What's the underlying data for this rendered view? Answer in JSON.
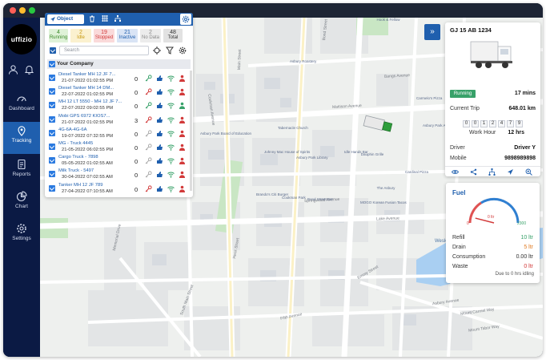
{
  "window": {
    "dots": [
      "#ff5f57",
      "#febc2e",
      "#28c840"
    ]
  },
  "brand": {
    "logo_text": "uffizio"
  },
  "sidebar": {
    "items": [
      {
        "label": "Dashboard",
        "icon": "speedometer-icon"
      },
      {
        "label": "Tracking",
        "icon": "location-pin-icon"
      },
      {
        "label": "Reports",
        "icon": "report-icon"
      },
      {
        "label": "Chart",
        "icon": "pie-chart-icon"
      },
      {
        "label": "Settings",
        "icon": "gear-icon"
      }
    ]
  },
  "panel": {
    "tab_object": "Object",
    "stats": [
      {
        "value": "4",
        "label": "Running",
        "bg": "#dff2d8",
        "color": "#3b8a2a"
      },
      {
        "value": "2",
        "label": "Idle",
        "bg": "#fbf1cf",
        "color": "#c79a12"
      },
      {
        "value": "19",
        "label": "Stopped",
        "bg": "#fadada",
        "color": "#d23a3a"
      },
      {
        "value": "21",
        "label": "Inactive",
        "bg": "#d9e4f5",
        "color": "#1f5fae"
      },
      {
        "value": "2",
        "label": "No Data",
        "bg": "#ececec",
        "color": "#888888"
      },
      {
        "value": "48",
        "label": "Total",
        "bg": "#e2e2e2",
        "color": "#333333"
      }
    ],
    "search_placeholder": "Search",
    "company": "Your Company",
    "rows": [
      {
        "name": "Diesel Tanker MH 12 JF 7...",
        "date": "21-07-2022 01:02:55 PM",
        "count": "0",
        "key": "#38a169",
        "person": "#d23a3a"
      },
      {
        "name": "Diesel Tanker MH 14 DM...",
        "date": "22-07-2022 01:02:55 PM",
        "count": "0",
        "key": "#d23a3a",
        "person": "#d23a3a"
      },
      {
        "name": "MH 12 LT 5550 - MH 12 JF 7...",
        "date": "22-07-2022 09:02:55 PM",
        "count": "0",
        "key": "#38a169",
        "person": "#38a169"
      },
      {
        "name": "Mobi GPS 6972 KIOS7...",
        "date": "21-07-2022 01:02:55 PM",
        "count": "3",
        "key": "#d23a3a",
        "person": "#d23a3a"
      },
      {
        "name": "4G-6A-4G-6A",
        "date": "19-07-2022 07:32:55 PM",
        "count": "0",
        "key": "#aaaaaa",
        "person": "#d23a3a"
      },
      {
        "name": "MG - Truck 4445",
        "date": "21-05-2022 06:02:55 PM",
        "count": "0",
        "key": "#aaaaaa",
        "person": "#d23a3a"
      },
      {
        "name": "Cargo Truck - 7898",
        "date": "05-05-2022 01:02:55 AM",
        "count": "0",
        "key": "#aaaaaa",
        "person": "#d23a3a"
      },
      {
        "name": "Milk Truck - 5497",
        "date": "30-04-2022 07:02:55 AM",
        "count": "0",
        "key": "#aaaaaa",
        "person": "#d23a3a"
      },
      {
        "name": "Tanker MH 12 JF 789",
        "date": "27-04-2022 07:10:55 AM",
        "count": "0",
        "key": "#d23a3a",
        "person": "#d23a3a"
      }
    ]
  },
  "vehicle": {
    "plate": "GJ 15 AB 1234",
    "status": "Running",
    "status_duration": "17 mins",
    "current_trip_label": "Current Trip",
    "current_trip_value": "648.01 km",
    "odometer_digits": [
      "0",
      "0",
      "1",
      "2",
      "4",
      "7",
      "9"
    ],
    "work_hour_label": "Work Hour",
    "work_hour_value": "12 hrs",
    "driver_label": "Driver",
    "driver_value": "Driver Y",
    "mobile_label": "Mobile",
    "mobile_value": "9898989898"
  },
  "fuel": {
    "title": "Fuel",
    "gauge_min": "0",
    "gauge_max": "2300",
    "gauge_value": "0 ltr",
    "gauge_fraction": 0.0,
    "rows": [
      {
        "label": "Refill",
        "value": "10 ltr",
        "color": "#38a169"
      },
      {
        "label": "Drain",
        "value": "5 ltr",
        "color": "#e07b22"
      },
      {
        "label": "Consumption",
        "value": "0.00 ltr",
        "color": "#333333"
      },
      {
        "label": "Waste",
        "value": "0 ltr",
        "color": "#d23a3a"
      }
    ],
    "footer": "Due to 0 hrs idling"
  },
  "map": {
    "roads": [
      "Springwood Avenue",
      "Main Street",
      "Lake Avenue",
      "Bangs Avenue",
      "Mattison Avenue",
      "Cookman Avenue",
      "Bond Street",
      "South Main Street",
      "Asbury Avenue",
      "Mount Carmel Way",
      "Mount Tabor Way",
      "Memorial Drive",
      "Fifth Avenue",
      "Heck Street",
      "Emory Street"
    ],
    "pois": [
      "Asbury Park",
      "Tabernacle Church",
      "Johnny Mac House of Spirits",
      "Asbury Park Library",
      "Carmelo's Pizza",
      "Brando's Citi Burger",
      "Cookman Park",
      "Bond Street Bar",
      "Idle Hands Bar",
      "Dauphin Grille",
      "The Asbury",
      "MOGO Korean Fusion Tacos",
      "Cardinal Pizza",
      "Asbury Park Academy of Dance",
      "Hook & Fellow",
      "Wesley Lake",
      "Asbury Park Board of Education",
      "Asbury Roastery"
    ]
  }
}
